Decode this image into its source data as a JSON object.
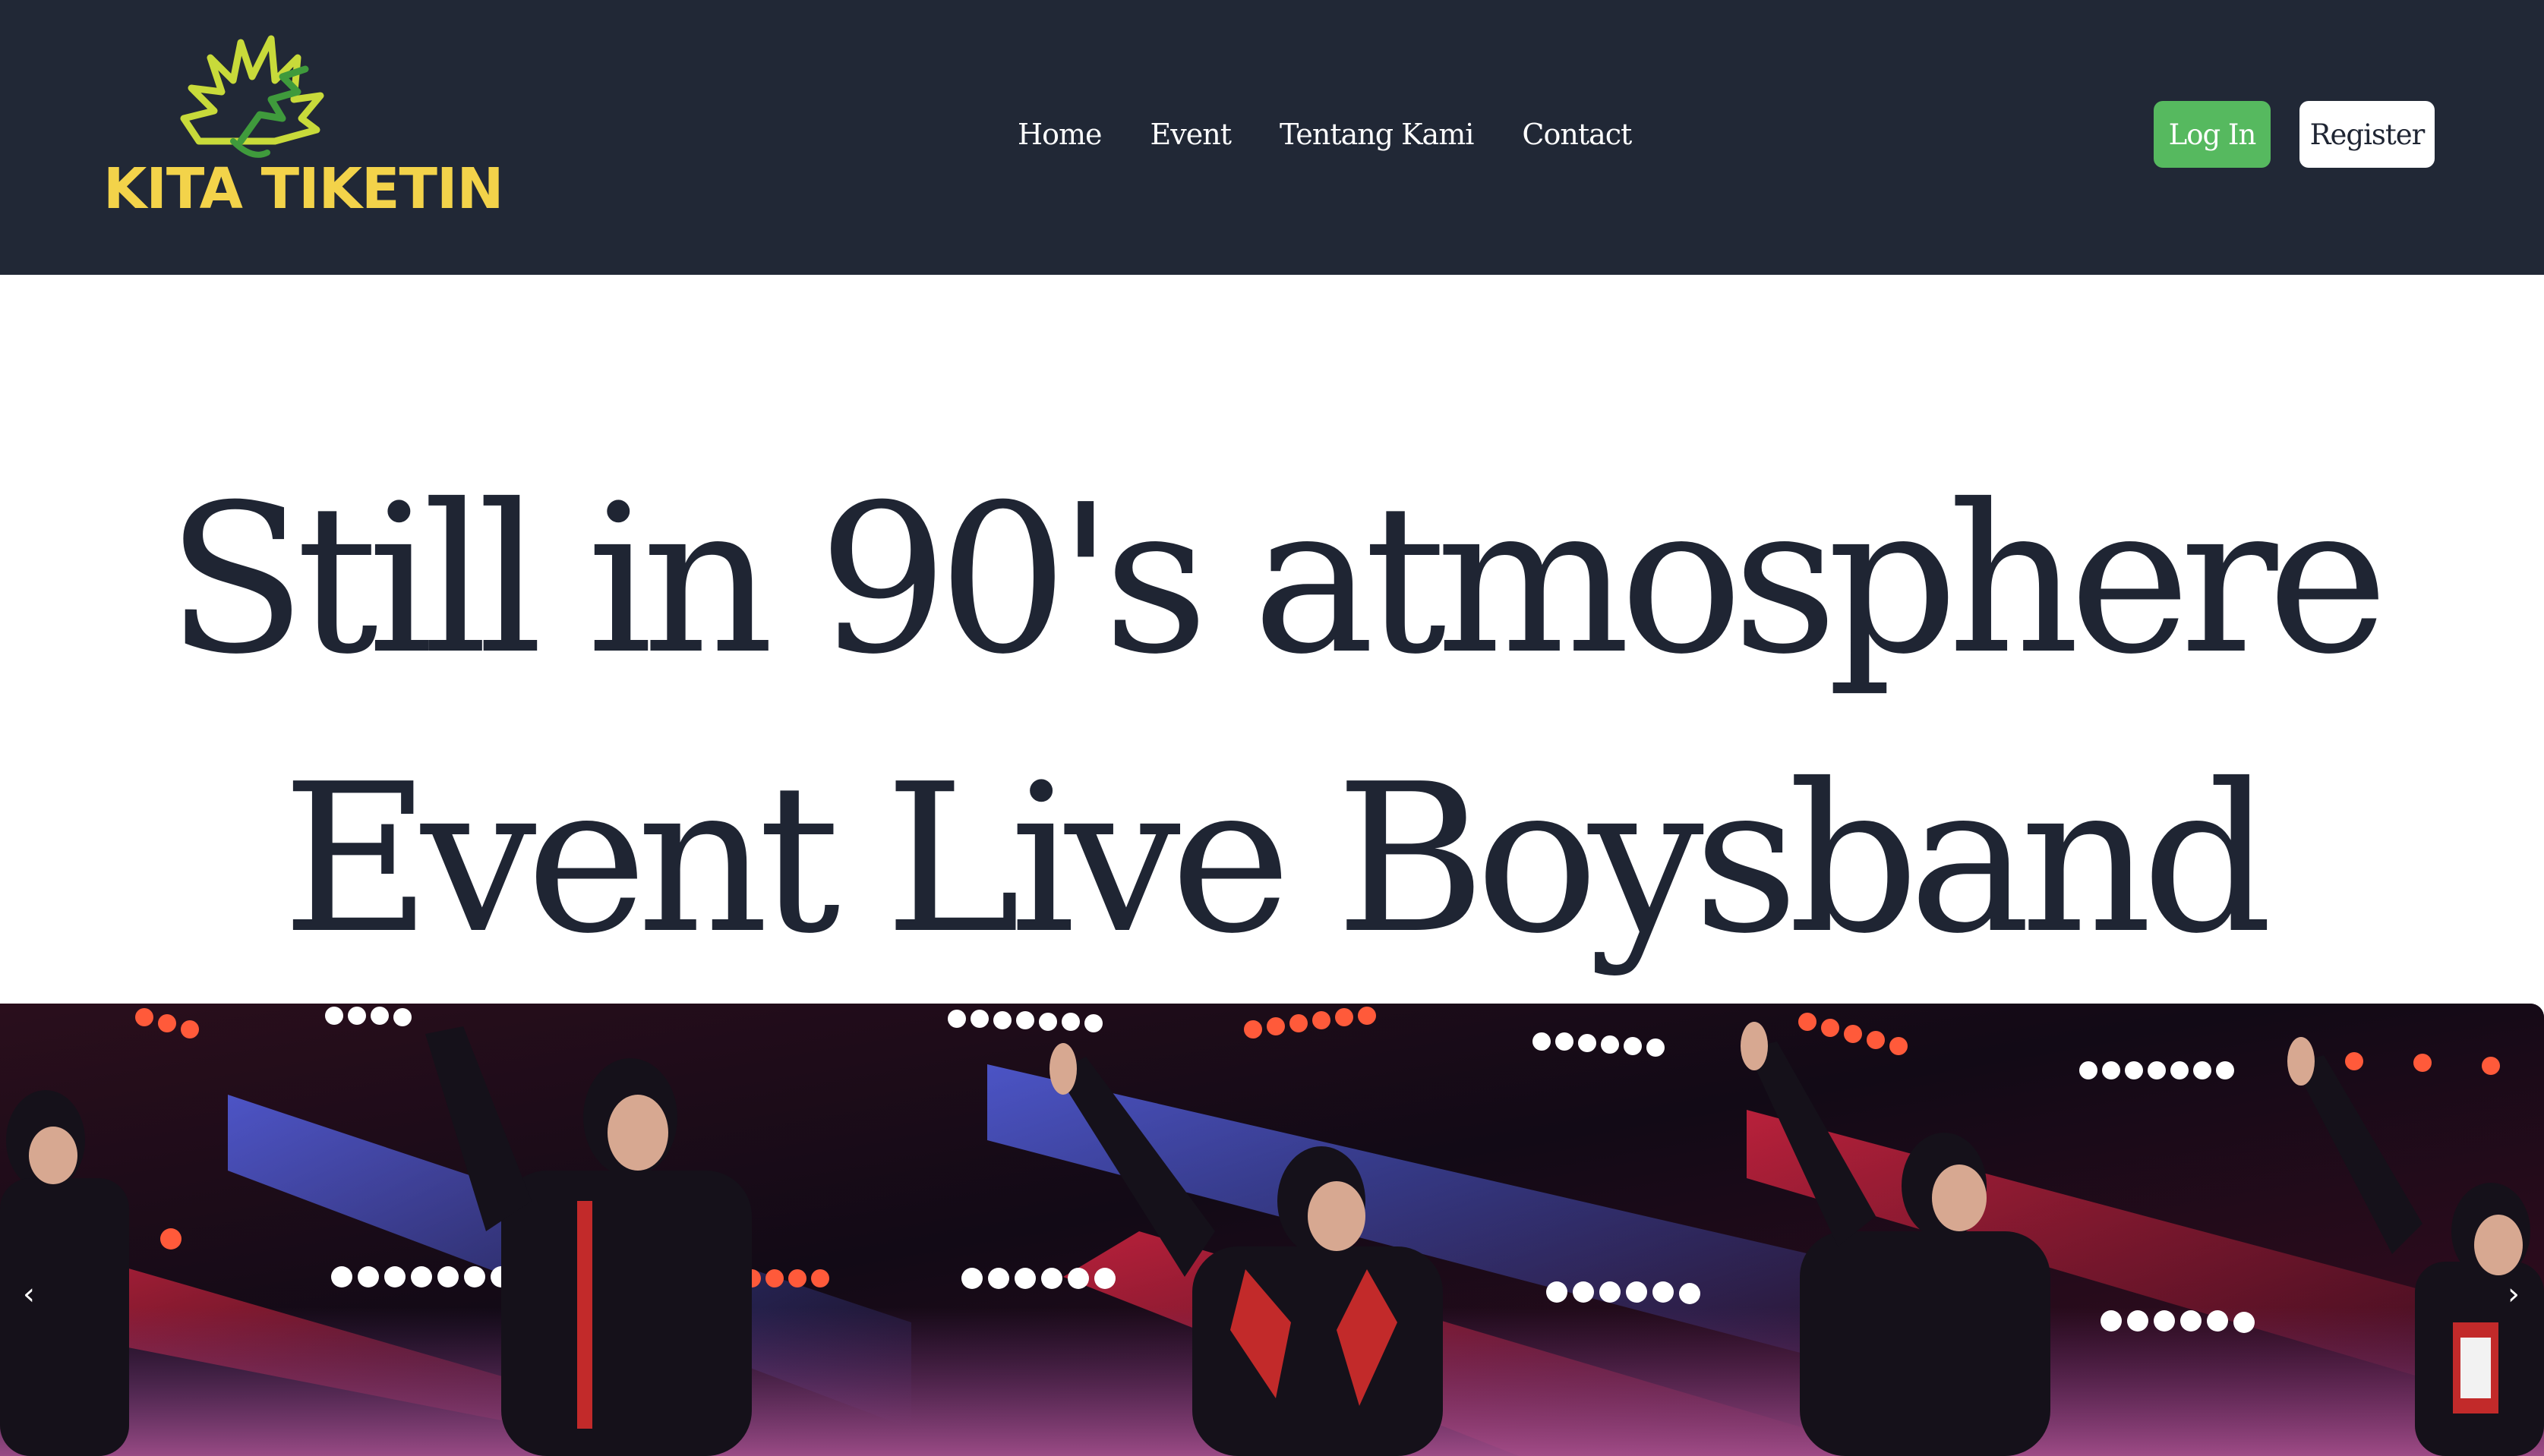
{
  "header": {
    "logo_text": "KITA TIKETIN",
    "logo_colors": {
      "text": "#f3d34a",
      "mark_light": "#c8da3a",
      "mark_dark": "#3f9a3c"
    },
    "background": "#212836"
  },
  "nav": {
    "items": [
      {
        "label": "Home"
      },
      {
        "label": "Event"
      },
      {
        "label": "Tentang Kami"
      },
      {
        "label": "Contact"
      }
    ]
  },
  "auth": {
    "login_label": "Log In",
    "register_label": "Register",
    "login_color": "#56b95f"
  },
  "hero": {
    "title_line1": "Still in 90's atmosphere",
    "title_line2": "Event Live Boysband",
    "text_color": "#1f2533"
  },
  "carousel": {
    "image_subject": "boyband performing live on stage with microphones",
    "prev_icon": "chevron-left-icon",
    "next_icon": "chevron-right-icon",
    "prev_glyph": "‹",
    "next_glyph": "›"
  }
}
